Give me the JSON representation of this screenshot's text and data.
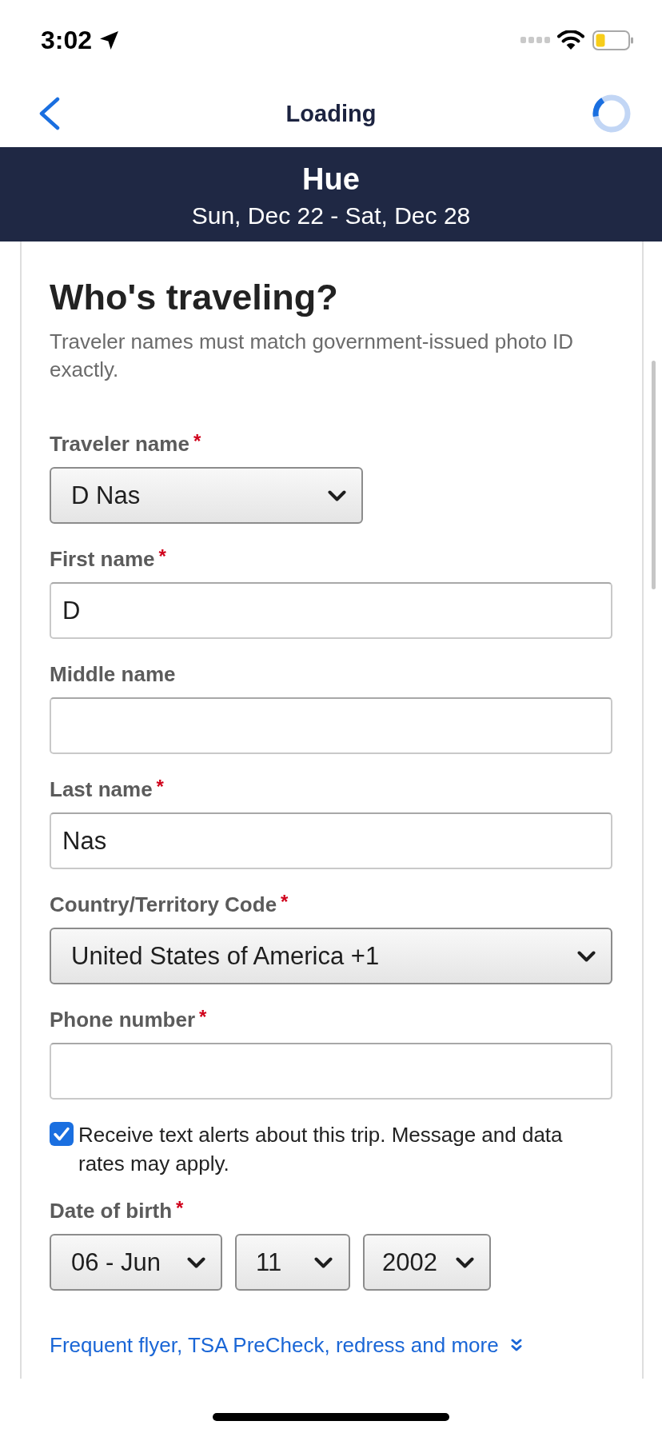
{
  "status_bar": {
    "time": "3:02"
  },
  "nav_bar": {
    "title": "Loading"
  },
  "trip_banner": {
    "destination": "Hue",
    "dates": "Sun, Dec 22 - Sat, Dec 28"
  },
  "form": {
    "title": "Who's traveling?",
    "subtitle": "Traveler names must match government-issued photo ID exactly.",
    "fields": [
      {
        "kind": "select",
        "label": "Traveler name",
        "required_mark": "*",
        "value": "D Nas"
      },
      {
        "kind": "text",
        "label": "First name",
        "required_mark": "*",
        "value": "D"
      },
      {
        "kind": "text",
        "label": "Middle name"
      },
      {
        "kind": "text",
        "label": "Last name",
        "required_mark": "*",
        "value": "Nas"
      },
      {
        "kind": "select",
        "label": "Country/Territory Code",
        "required_mark": "*",
        "value": "United States of America +1"
      },
      {
        "kind": "text",
        "label": "Phone number",
        "required_mark": "*"
      },
      {
        "kind": "checkbox",
        "label": "Receive text alerts about this trip. Message and data rates may apply.",
        "checked": true
      },
      {
        "kind": "date",
        "label": "Date of birth",
        "required_mark": "*",
        "parts": [
          "06 - Jun",
          "11",
          "2002"
        ]
      }
    ],
    "more_link": "Frequent flyer, TSA PreCheck, redress and more"
  }
}
